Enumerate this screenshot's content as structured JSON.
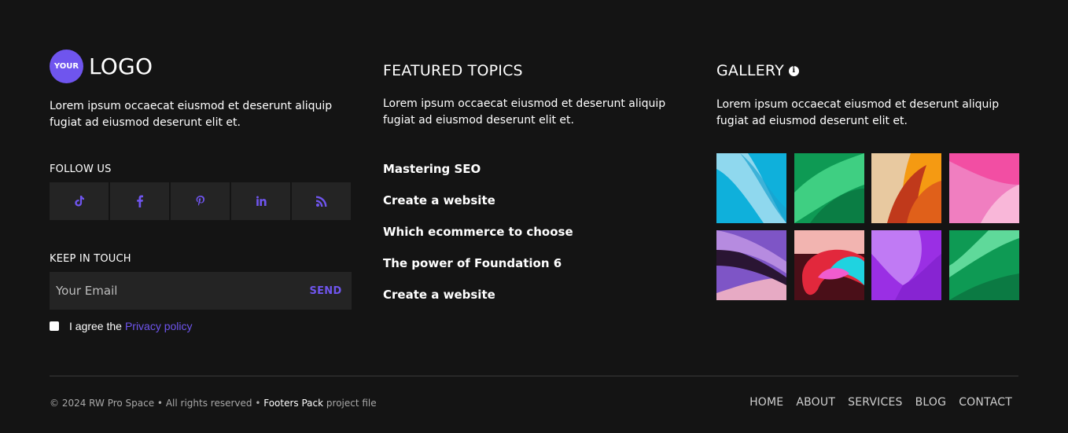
{
  "brand": {
    "badge_text": "YOUR",
    "logo_text": "LOGO",
    "description": "Lorem ipsum occaecat eiusmod et deserunt aliquip fugiat ad eiusmod deserunt elit et.",
    "accent_color": "#6f55ee"
  },
  "follow": {
    "heading": "FOLLOW US",
    "icons": [
      "tiktok-icon",
      "facebook-icon",
      "pinterest-icon",
      "linkedin-icon",
      "rss-icon"
    ]
  },
  "newsletter": {
    "heading": "KEEP IN TOUCH",
    "email_placeholder": "Your Email",
    "send_label": "SEND",
    "agree_text": "I agree the",
    "privacy_link": "Privacy policy"
  },
  "topics": {
    "heading": "FEATURED TOPICS",
    "description": "Lorem ipsum occaecat eiusmod et deserunt aliquip fugiat ad eiusmod deserunt elit et.",
    "items": [
      "Mastering SEO",
      "Create a website",
      "Which ecommerce to choose",
      "The power of Foundation 6",
      "Create a website"
    ]
  },
  "gallery": {
    "heading": "GALLERY",
    "description": "Lorem ipsum occaecat eiusmod et deserunt aliquip fugiat ad eiusmod deserunt elit et.",
    "tile_colors": [
      "#19b5d8",
      "#1fa35c",
      "#e88a1a",
      "#ee6fb0",
      "#7b4bb0",
      "#e23e4a",
      "#9b3ae0",
      "#22a75e"
    ]
  },
  "footer": {
    "copyright_prefix": "© 2024 RW Pro Space • All rights reserved •",
    "copyright_highlight": "Footers Pack",
    "copyright_suffix": "project file",
    "nav": [
      "HOME",
      "ABOUT",
      "SERVICES",
      "BLOG",
      "CONTACT"
    ]
  }
}
